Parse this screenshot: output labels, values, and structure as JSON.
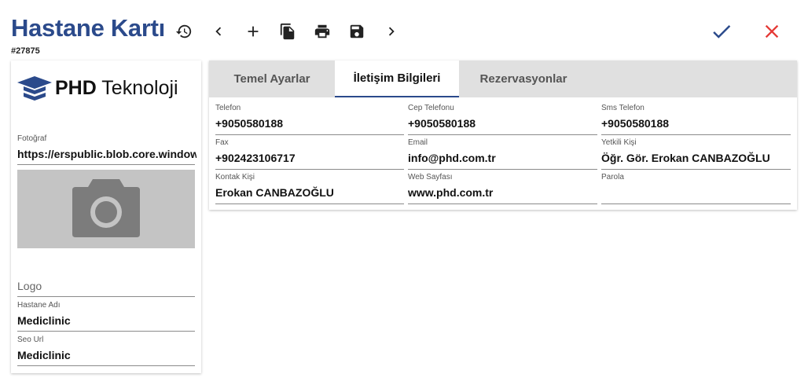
{
  "header": {
    "title": "Hastane Kartı",
    "record_id": "#27875"
  },
  "toolbar": {
    "icons": [
      "history-icon",
      "chevron-left-icon",
      "plus-icon",
      "copy-icon",
      "print-icon",
      "save-icon",
      "chevron-right-icon",
      "check-icon",
      "close-icon"
    ]
  },
  "colors": {
    "brand": "#2b4a8b",
    "close": "#e53935"
  },
  "left": {
    "logo_bold": "PHD",
    "logo_light": "Teknoloji",
    "photo_label": "Fotoğraf",
    "photo_value": "https://erspublic.blob.core.windows",
    "logo_placeholder": "Logo",
    "hospital_label": "Hastane Adı",
    "hospital_value": "Mediclinic",
    "seo_label": "Seo Url",
    "seo_value": "Mediclinic"
  },
  "tabs": [
    {
      "label": "Temel Ayarlar",
      "active": false
    },
    {
      "label": "İletişim Bilgileri",
      "active": true
    },
    {
      "label": "Rezervasyonlar",
      "active": false
    }
  ],
  "contact": {
    "phone_label": "Telefon",
    "phone_value": "+9050580188",
    "mobile_label": "Cep Telefonu",
    "mobile_value": "+9050580188",
    "sms_label": "Sms Telefon",
    "sms_value": "+9050580188",
    "fax_label": "Fax",
    "fax_value": "+902423106717",
    "email_label": "Email",
    "email_value": "info@phd.com.tr",
    "authorized_label": "Yetkili Kişi",
    "authorized_value": "Öğr. Gör. Erokan CANBAZOĞLU",
    "contact_label": "Kontak Kişi",
    "contact_value": "Erokan CANBAZOĞLU",
    "web_label": "Web Sayfası",
    "web_value": "www.phd.com.tr",
    "password_label": "Parola",
    "password_value": ""
  }
}
